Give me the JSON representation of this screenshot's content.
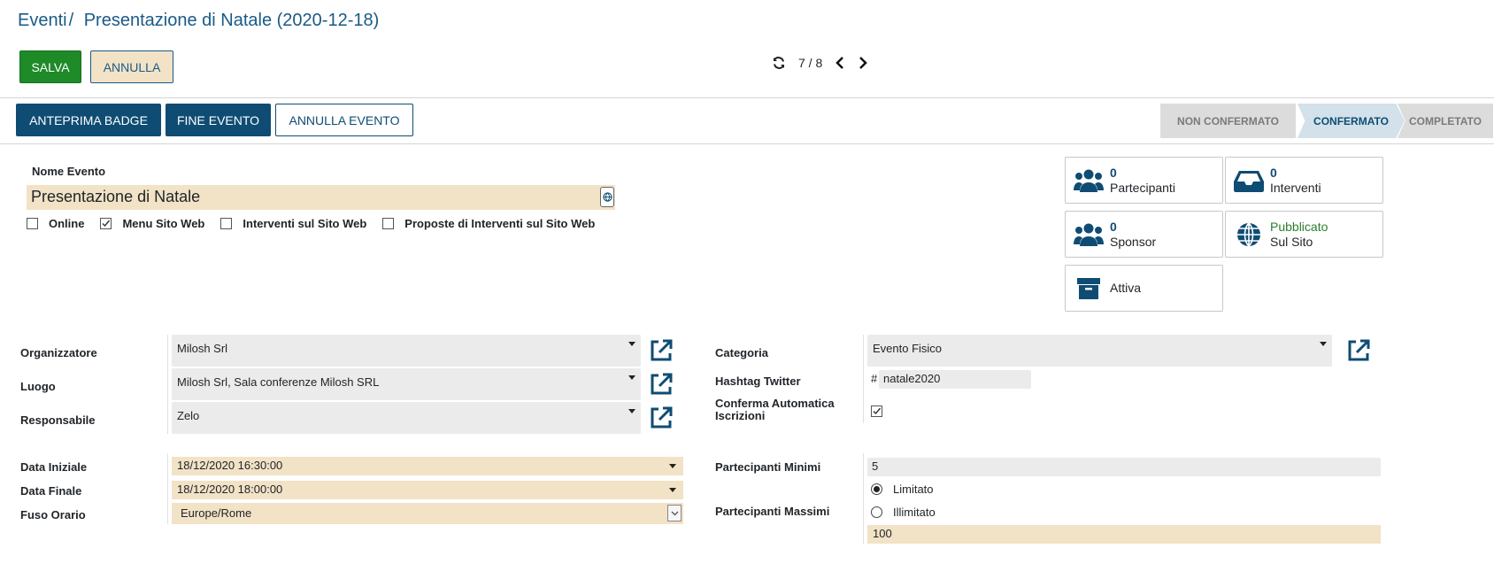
{
  "breadcrumb": {
    "parent": "Eventi",
    "current": "Presentazione di Natale (2020-12-18)"
  },
  "toolbar": {
    "save_label": "SALVA",
    "cancel_label": "ANNULLA"
  },
  "pager": {
    "value": "7 / 8"
  },
  "actions": {
    "badge": "ANTEPRIMA BADGE",
    "end": "FINE EVENTO",
    "cancel_event": "ANNULLA EVENTO"
  },
  "status": {
    "s1": "NON CONFERMATO",
    "s2": "CONFERMATO",
    "s3": "COMPLETATO"
  },
  "event": {
    "name_label": "Nome Evento",
    "name": "Presentazione di Natale",
    "checkboxes": [
      {
        "label": "Online",
        "checked": false
      },
      {
        "label": "Menu Sito Web",
        "checked": true
      },
      {
        "label": "Interventi sul Sito Web",
        "checked": false
      },
      {
        "label": "Proposte di Interventi sul Sito Web",
        "checked": false
      }
    ]
  },
  "stats": {
    "partecipanti": {
      "num": "0",
      "label": "Partecipanti"
    },
    "interventi": {
      "num": "0",
      "label": "Interventi"
    },
    "sponsor": {
      "num": "0",
      "label": "Sponsor"
    },
    "pubblicato": {
      "line1": "Pubblicato",
      "line2": "Sul Sito"
    },
    "attiva": {
      "label": "Attiva"
    }
  },
  "left_form": {
    "organizzatore_label": "Organizzatore",
    "organizzatore": "Milosh Srl",
    "luogo_label": "Luogo",
    "luogo": "Milosh Srl, Sala conferenze Milosh SRL",
    "responsabile_label": "Responsabile",
    "responsabile": "Zelo",
    "data_iniziale_label": "Data Iniziale",
    "data_iniziale": "18/12/2020 16:30:00",
    "data_finale_label": "Data Finale",
    "data_finale": "18/12/2020 18:00:00",
    "fuso_label": "Fuso Orario",
    "fuso": "Europe/Rome"
  },
  "right_form": {
    "categoria_label": "Categoria",
    "categoria": "Evento Fisico",
    "hashtag_label": "Hashtag Twitter",
    "hashtag_prefix": "#",
    "hashtag": "natale2020",
    "conferma_label_1": "Conferma Automatica",
    "conferma_label_2": "Iscrizioni",
    "conferma_checked": true,
    "min_label": "Partecipanti Minimi",
    "min": "5",
    "max_label": "Partecipanti Massimi",
    "radio_limitato": "Limitato",
    "radio_illimitato": "Illimitato",
    "max": "100"
  },
  "colors": {
    "primary": "#0f4c73",
    "save": "#1e8a28",
    "required": "#f2e2c6"
  }
}
